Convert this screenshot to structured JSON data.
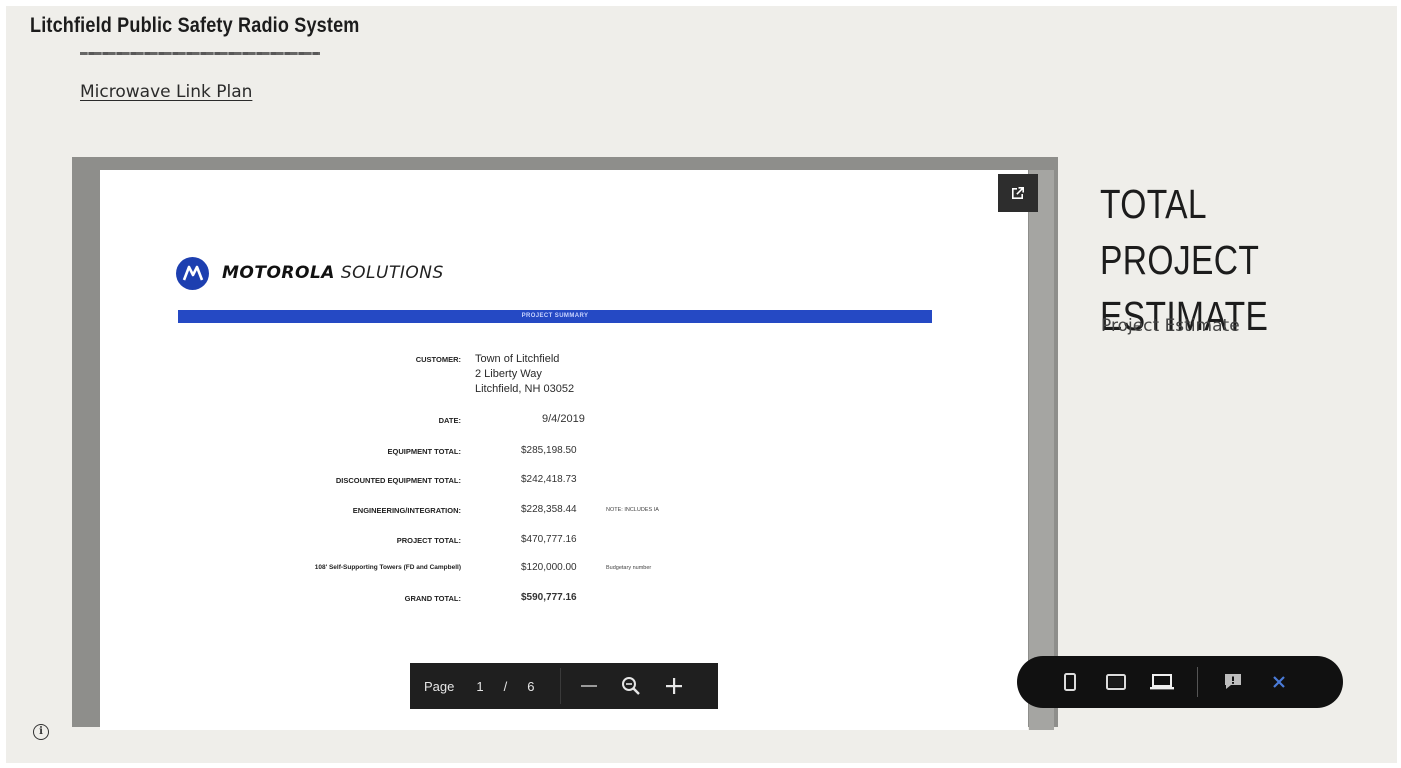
{
  "site": {
    "title": "Litchfield Public Safety Radio System",
    "link_text": "Microwave Link Plan"
  },
  "document": {
    "brand_bold": "MOTOROLA",
    "brand_light": "SOLUTIONS",
    "banner": "PROJECT SUMMARY",
    "customer_label": "CUSTOMER:",
    "customer_lines": [
      "Town of Litchfield",
      "2 Liberty Way",
      "Litchfield, NH 03052"
    ],
    "rows": [
      {
        "label": "DATE:",
        "value": "9/4/2019",
        "note": ""
      },
      {
        "label": "EQUIPMENT TOTAL:",
        "value": "$285,198.50",
        "note": ""
      },
      {
        "label": "DISCOUNTED EQUIPMENT TOTAL:",
        "value": "$242,418.73",
        "note": ""
      },
      {
        "label": "ENGINEERING/INTEGRATION:",
        "value": "$228,358.44",
        "note": "NOTE: INCLUDES IA"
      },
      {
        "label": "PROJECT TOTAL:",
        "value": "$470,777.16",
        "note": ""
      },
      {
        "label": "108' Self-Supporting Towers (FD and Campbell)",
        "value": "$120,000.00",
        "note": "Budgetary number"
      },
      {
        "label": "GRAND TOTAL:",
        "value": "$590,777.16",
        "note": ""
      }
    ]
  },
  "viewer_toolbar": {
    "page_label": "Page",
    "current_page": "1",
    "separator": "/",
    "total_pages": "6"
  },
  "aside": {
    "heading_line1": "TOTAL PROJECT",
    "heading_line2": "ESTIMATE",
    "subtitle": "Project Estimate"
  },
  "colors": {
    "page_bg": "#efeeea",
    "viewer_frame": "#8e8e8b",
    "banner_blue": "#2549c4",
    "moto_blue": "#1d3fb0",
    "toolbar_bg": "#1f1f1f",
    "pill_bg": "#111111",
    "close_x": "#4a7bd8"
  },
  "icons": {
    "popout": "open-in-new-icon",
    "zoom": "zoom-icon",
    "info": "info-icon"
  }
}
